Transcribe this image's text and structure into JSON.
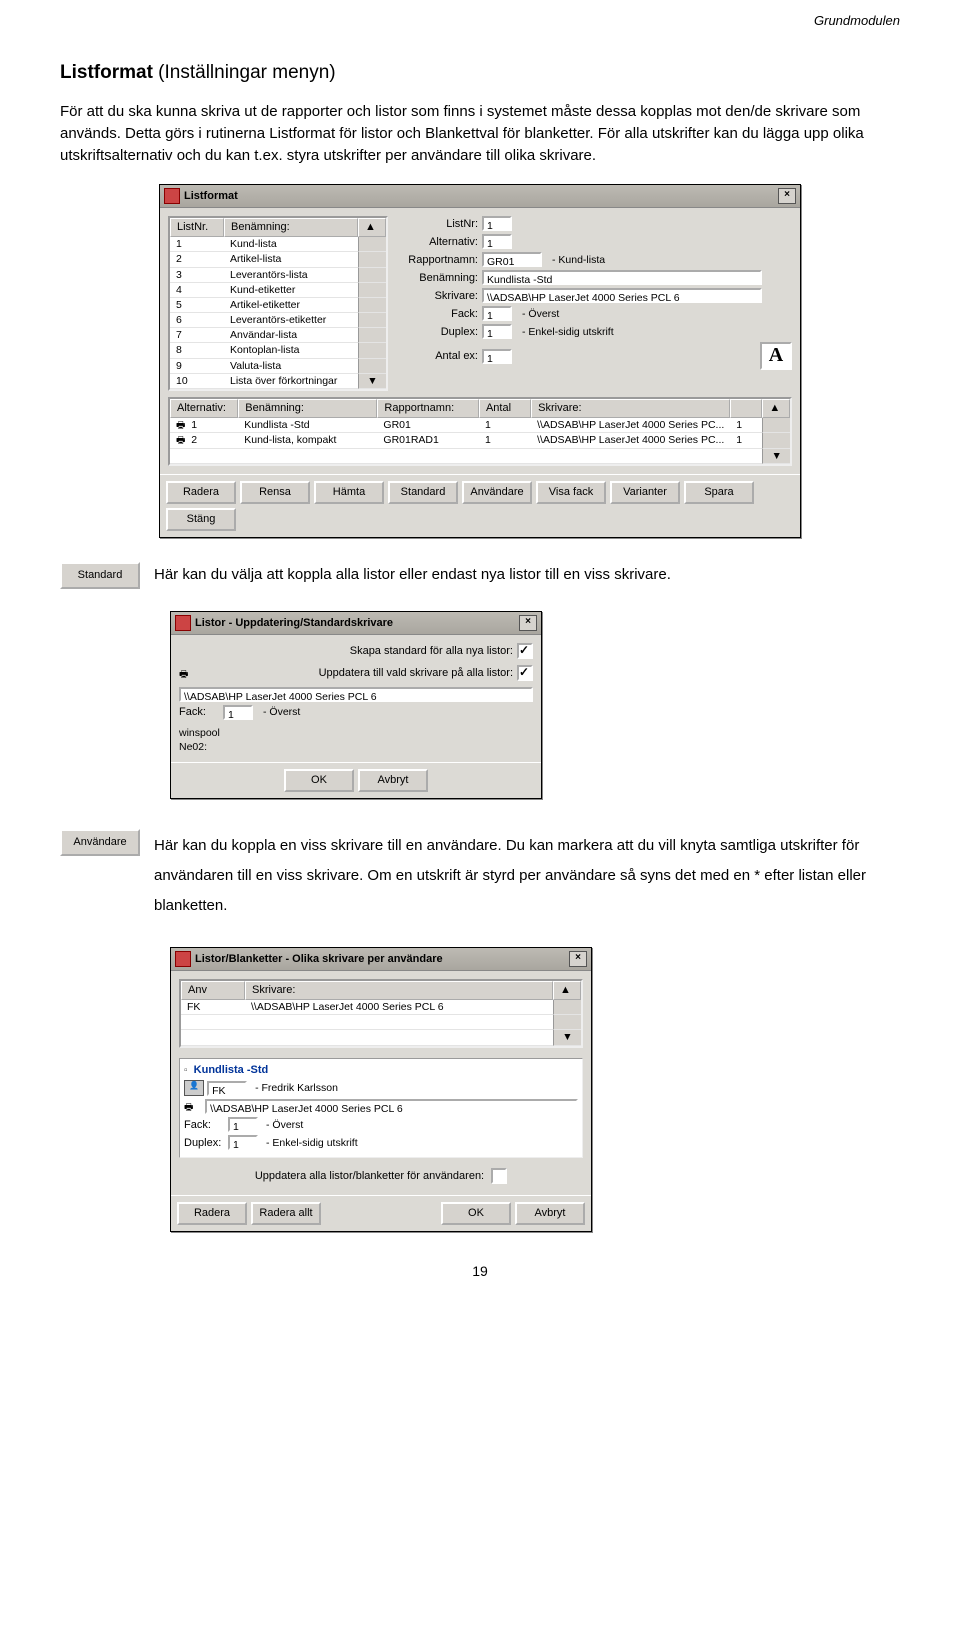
{
  "header": "Grundmodulen",
  "title": {
    "main": "Listformat",
    "sub": "  (Inställningar menyn)"
  },
  "para1": "För att du ska kunna skriva ut de rapporter och listor som finns i systemet måste dessa kopplas mot den/de skrivare som används. Detta görs i rutinerna Listformat för listor och Blankettval för blanketter. För alla utskrifter kan du lägga upp olika utskriftsalternativ och du kan t.ex. styra utskrifter per användare till olika skrivare.",
  "win1": {
    "title": "Listformat",
    "list_head": [
      "ListNr.",
      "Benämning:"
    ],
    "list_rows": [
      [
        "1",
        "Kund-lista"
      ],
      [
        "2",
        "Artikel-lista"
      ],
      [
        "3",
        "Leverantörs-lista"
      ],
      [
        "4",
        "Kund-etiketter"
      ],
      [
        "5",
        "Artikel-etiketter"
      ],
      [
        "6",
        "Leverantörs-etiketter"
      ],
      [
        "7",
        "Användar-lista"
      ],
      [
        "8",
        "Kontoplan-lista"
      ],
      [
        "9",
        "Valuta-lista"
      ],
      [
        "10",
        "Lista över förkortningar"
      ]
    ],
    "form": {
      "l_listnr": "ListNr:",
      "v_listnr": "1",
      "l_alt": "Alternativ:",
      "v_alt": "1",
      "l_rapp": "Rapportnamn:",
      "v_rapp": "GR01",
      "v_rapp2": "- Kund-lista",
      "l_ben": "Benämning:",
      "v_ben": "Kundlista -Std",
      "l_skr": "Skrivare:",
      "v_skr": "\\\\ADSAB\\HP LaserJet 4000 Series PCL 6",
      "l_fack": "Fack:",
      "v_fack": "1",
      "v_fack2": "- Överst",
      "l_dup": "Duplex:",
      "v_dup": "1",
      "v_dup2": "- Enkel-sidig utskrift",
      "l_ant": "Antal ex:",
      "v_ant": "1",
      "bigA": "A"
    },
    "alt_head": [
      "Alternativ:",
      "Benämning:",
      "Rapportnamn:",
      "Antal",
      "Skrivare:",
      ""
    ],
    "alt_rows": [
      [
        "1",
        "Kundlista -Std",
        "GR01",
        "1",
        "\\\\ADSAB\\HP LaserJet 4000 Series PC...",
        "1"
      ],
      [
        "2",
        "Kund-lista, kompakt",
        "GR01RAD1",
        "1",
        "\\\\ADSAB\\HP LaserJet 4000 Series PC...",
        "1"
      ]
    ],
    "buttons": [
      "Radera",
      "Rensa",
      "Hämta",
      "Standard",
      "Användare",
      "Visa fack",
      "Varianter",
      "Spara",
      "Stäng"
    ]
  },
  "sec_std": {
    "btn": "Standard",
    "text": "Här kan du välja att koppla alla listor eller endast nya listor till en viss skrivare."
  },
  "win2": {
    "title": "Listor - Uppdatering/Standardskrivare",
    "l1": "Skapa standard för alla nya listor:",
    "l2": "Uppdatera till vald skrivare på alla listor:",
    "printer": "\\\\ADSAB\\HP LaserJet 4000 Series PCL 6",
    "l_fack": "Fack:",
    "v_fack": "1",
    "v_fack2": "- Överst",
    "extra1": "winspool",
    "extra2": "Ne02:",
    "buttons": [
      "OK",
      "Avbryt"
    ]
  },
  "sec_anv": {
    "btn": "Användare",
    "text": "Här kan du koppla en viss skrivare till en användare. Du kan markera att du vill knyta samtliga utskrifter för användaren till en viss skrivare. Om en utskrift är styrd per användare så syns det med en * efter listan eller blanketten."
  },
  "win3": {
    "title": "Listor/Blanketter - Olika skrivare per användare",
    "top_head": [
      "Anv",
      "Skrivare:"
    ],
    "top_row": [
      "FK",
      "\\\\ADSAB\\HP LaserJet 4000 Series PCL 6"
    ],
    "sel": "Kundlista -Std",
    "fk": "FK",
    "fk2": "- Fredrik Karlsson",
    "printer": "\\\\ADSAB\\HP LaserJet 4000 Series PCL 6",
    "l_fack": "Fack:",
    "v_fack": "1",
    "v_fack2": "- Överst",
    "l_dup": "Duplex:",
    "v_dup": "1",
    "v_dup2": "- Enkel-sidig utskrift",
    "l_upd": "Uppdatera alla listor/blanketter för användaren:",
    "buttons": [
      "Radera",
      "Radera allt",
      "OK",
      "Avbryt"
    ]
  },
  "pageno": "19"
}
